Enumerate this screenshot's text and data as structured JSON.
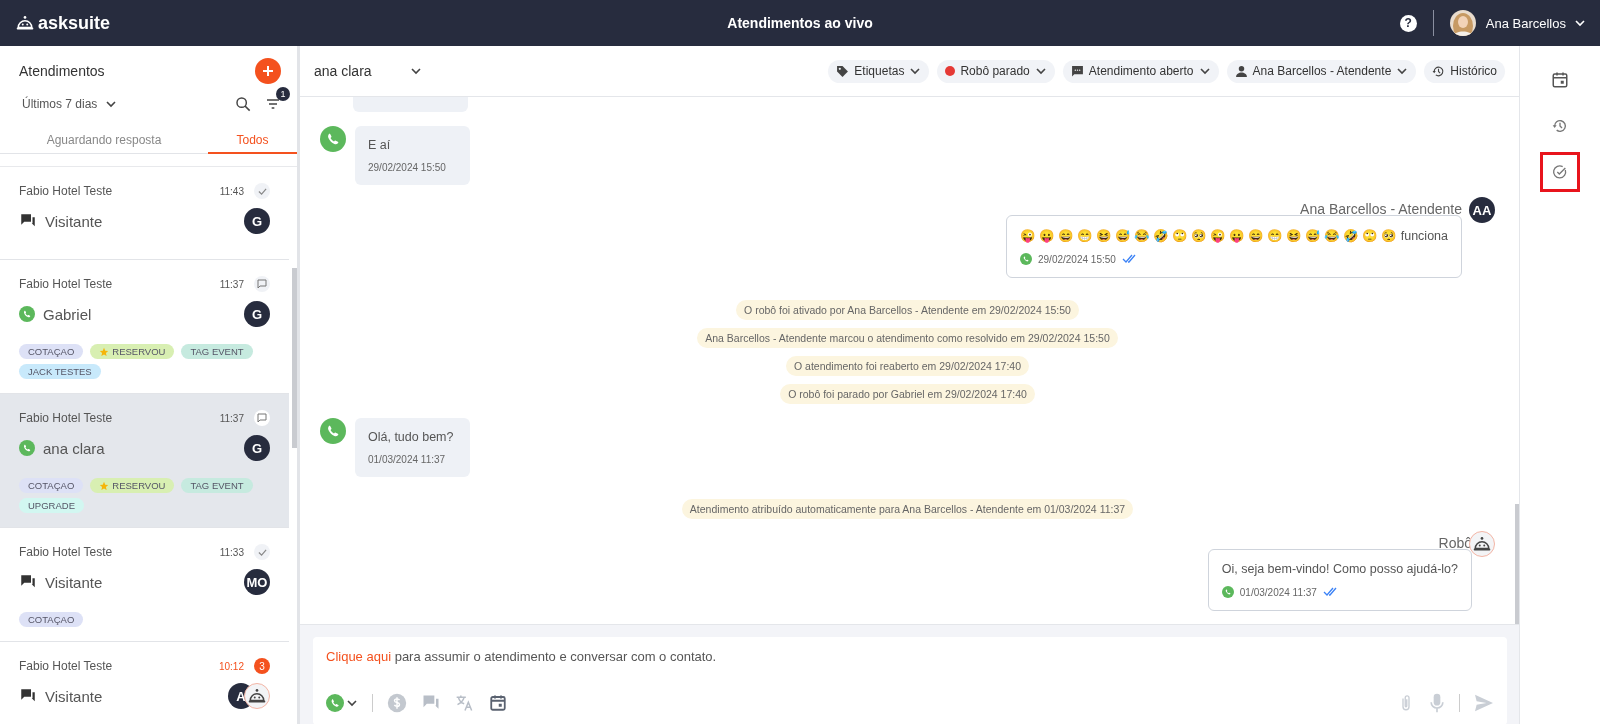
{
  "topbar": {
    "logo": "asksuite",
    "title": "Atendimentos ao vivo",
    "help": "?",
    "user": {
      "name": "Ana Barcellos"
    }
  },
  "sidebar": {
    "title": "Atendimentos",
    "period": "Últimos 7 dias",
    "filter_count": "1",
    "tabs": [
      {
        "label": "Aguardando resposta",
        "selected": false
      },
      {
        "label": "Todos",
        "selected": true
      }
    ],
    "items": [
      {
        "company": "Fabio Hotel Teste",
        "time": "11:43",
        "status": {
          "kind": "check"
        },
        "kind": "chat",
        "name": "Visitante",
        "avatars": [
          {
            "kind": "initials",
            "text": "G"
          }
        ],
        "selected": false
      },
      {
        "company": "Fabio Hotel Teste",
        "time": "11:37",
        "status": {
          "kind": "chat"
        },
        "kind": "whatsapp",
        "name": "Gabriel",
        "avatars": [
          {
            "kind": "initials",
            "text": "G"
          }
        ],
        "tags": [
          {
            "label": "COTAÇAO",
            "color": "#dde1f6",
            "star": false
          },
          {
            "label": "RESERVOU",
            "color": "#d8efb2",
            "star": true
          },
          {
            "label": "TAG EVENT",
            "color": "#c6eadf",
            "star": false
          },
          {
            "label": "JACK TESTES",
            "color": "#c8e9fb",
            "star": false
          }
        ],
        "selected": false
      },
      {
        "company": "Fabio Hotel Teste",
        "time": "11:37",
        "status": {
          "kind": "chat"
        },
        "kind": "whatsapp",
        "name": "ana clara",
        "avatars": [
          {
            "kind": "initials",
            "text": "G"
          }
        ],
        "tags": [
          {
            "label": "COTAÇAO",
            "color": "#dde1f6",
            "star": false
          },
          {
            "label": "RESERVOU",
            "color": "#d8efb2",
            "star": true
          },
          {
            "label": "TAG EVENT",
            "color": "#c6eadf",
            "star": false
          },
          {
            "label": "UPGRADE",
            "color": "#d2f7f1",
            "star": false
          }
        ],
        "selected": true
      },
      {
        "company": "Fabio Hotel Teste",
        "time": "11:33",
        "status": {
          "kind": "check"
        },
        "kind": "chat",
        "name": "Visitante",
        "avatars": [
          {
            "kind": "initials",
            "text": "MO"
          }
        ],
        "tags": [
          {
            "label": "COTAÇAO",
            "color": "#dde1f6",
            "star": false
          }
        ],
        "selected": false
      },
      {
        "company": "Fabio Hotel Teste",
        "time": "10:12",
        "status": {
          "kind": "unread",
          "count": "3"
        },
        "kind": "chat",
        "name": "Visitante",
        "avatars": [
          {
            "kind": "initials",
            "text": "A"
          },
          {
            "kind": "robot"
          }
        ],
        "selected": false
      }
    ]
  },
  "chat": {
    "contact": "ana clara",
    "chips": [
      {
        "kind": "tag",
        "label": "Etiquetas"
      },
      {
        "kind": "dot",
        "label": "Robô parado",
        "color": "#e53935"
      },
      {
        "kind": "chat",
        "label": "Atendimento aberto"
      },
      {
        "kind": "person",
        "label": "Ana Barcellos - Atendente"
      },
      {
        "kind": "history",
        "label": "Histórico"
      }
    ],
    "messages": [
      {
        "kind": "cut"
      },
      {
        "kind": "incoming",
        "text": "E aí",
        "time": "29/02/2024 15:50"
      },
      {
        "kind": "outgoing",
        "sender": "Ana Barcellos - Atendente",
        "avatar": {
          "kind": "initials",
          "text": "AA"
        },
        "text": "😜 😛 😄 😁 😆 😅 😂 🤣 🙄 🥺 😜 😛 😄 😁 😆 😅 😂 🤣 🙄 🥺 funciona",
        "time": "29/02/2024 15:50"
      },
      {
        "kind": "system",
        "text": "O robô foi ativado por Ana Barcellos - Atendente em 29/02/2024 15:50"
      },
      {
        "kind": "system",
        "text": "Ana Barcellos - Atendente marcou o atendimento como resolvido em 29/02/2024 15:50"
      },
      {
        "kind": "system",
        "text": "O atendimento foi reaberto em 29/02/2024 17:40"
      },
      {
        "kind": "system",
        "text": "O robô foi parado por Gabriel em 29/02/2024 17:40"
      },
      {
        "kind": "incoming",
        "text": "Olá, tudo bem?",
        "time": "01/03/2024 11:37"
      },
      {
        "kind": "system",
        "text": "Atendimento atribuído automaticamente para Ana Barcellos - Atendente em 01/03/2024 11:37"
      },
      {
        "kind": "outgoing",
        "sender": "Robô",
        "avatar": {
          "kind": "robot"
        },
        "text": "Oi, seja bem-vindo! Como posso ajudá-lo?",
        "time": "01/03/2024 11:37"
      }
    ],
    "composer": {
      "link": "Clique aqui",
      "text": " para assumir o atendimento e conversar com o contato."
    }
  },
  "rail": [
    {
      "kind": "calendar",
      "highlighted": false
    },
    {
      "kind": "history",
      "highlighted": false
    },
    {
      "kind": "check",
      "highlighted": true
    }
  ]
}
